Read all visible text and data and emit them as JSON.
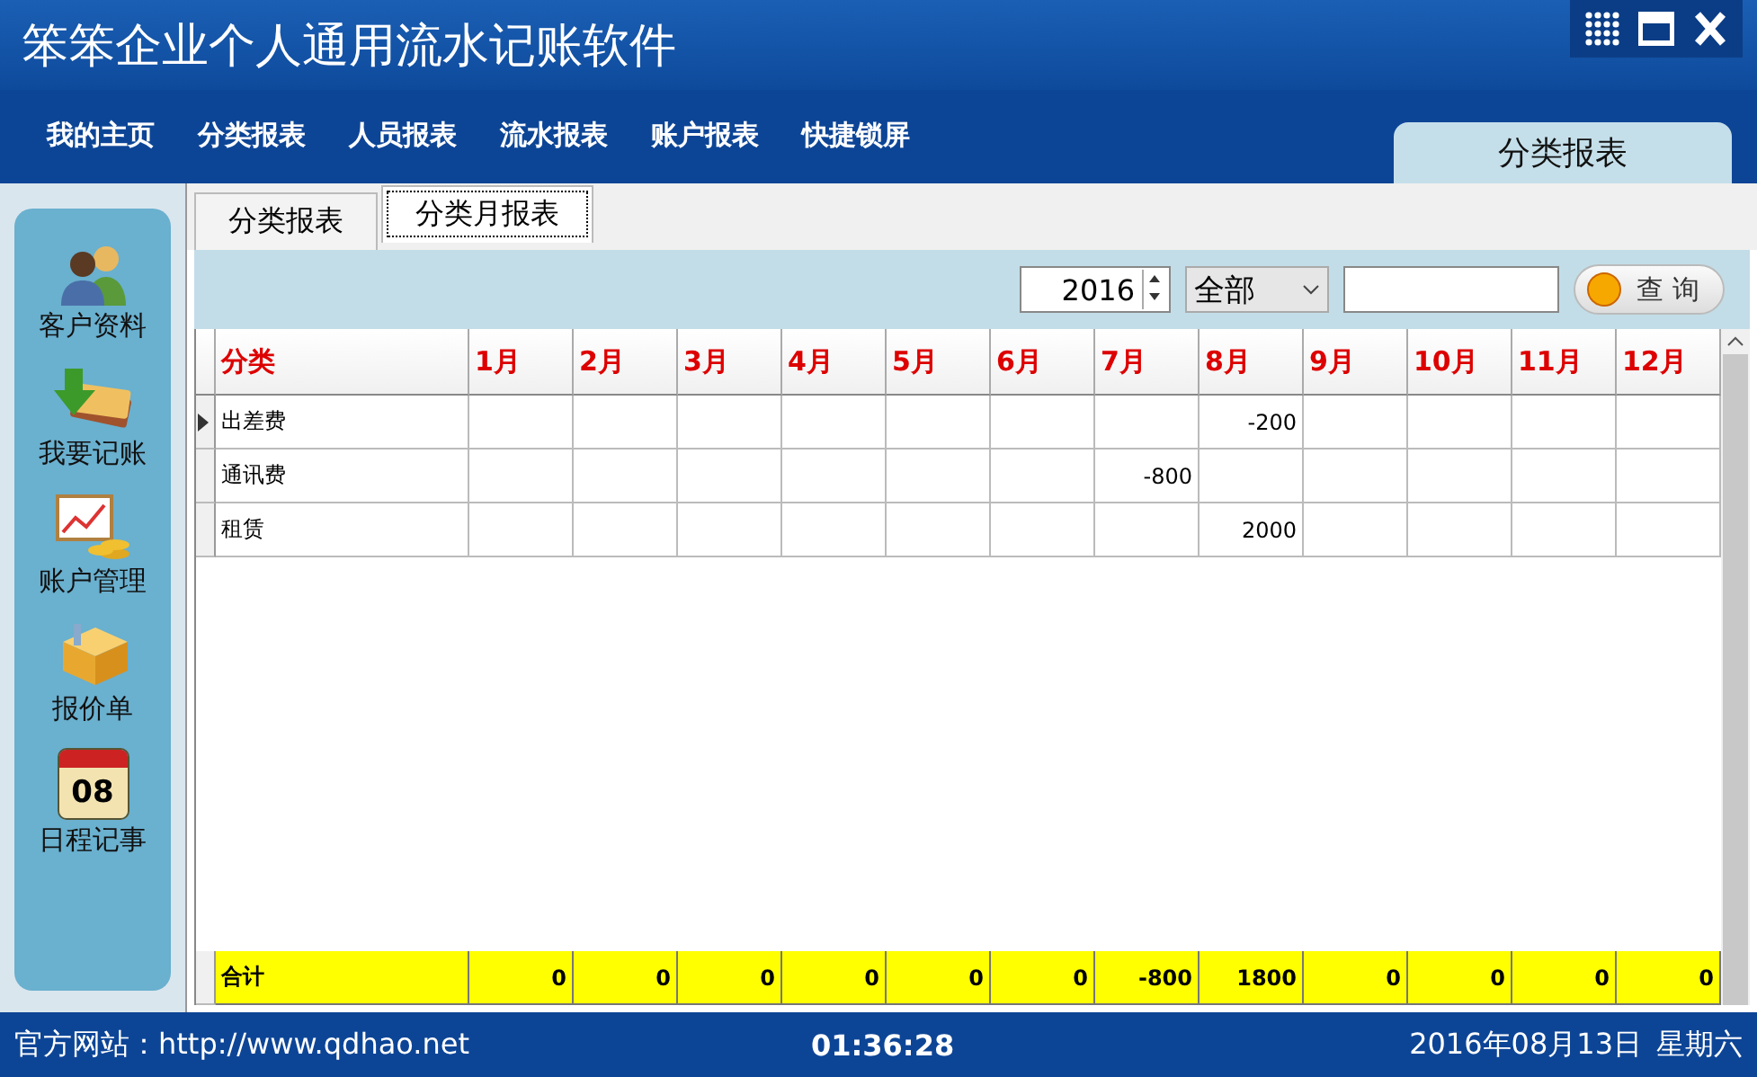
{
  "window": {
    "title": "笨笨企业个人通用流水记账软件"
  },
  "menu": [
    "我的主页",
    "分类报表",
    "人员报表",
    "流水报表",
    "账户报表",
    "快捷锁屏"
  ],
  "current_page": "分类报表",
  "sidebar": {
    "items": [
      {
        "label": "客户资料"
      },
      {
        "label": "我要记账"
      },
      {
        "label": "账户管理"
      },
      {
        "label": "报价单"
      },
      {
        "label": "日程记事",
        "icon_text": "08"
      }
    ]
  },
  "tabs": [
    {
      "label": "分类报表",
      "selected": false
    },
    {
      "label": "分类月报表",
      "selected": true
    }
  ],
  "toolbar": {
    "year": "2016",
    "filter": "全部",
    "query_button": "查 询"
  },
  "table": {
    "columns": [
      "分类",
      "1月",
      "2月",
      "3月",
      "4月",
      "5月",
      "6月",
      "7月",
      "8月",
      "9月",
      "10月",
      "11月",
      "12月"
    ],
    "rows": [
      {
        "current": true,
        "cells": [
          "出差费",
          "",
          "",
          "",
          "",
          "",
          "",
          "",
          "-200",
          "",
          "",
          "",
          ""
        ]
      },
      {
        "current": false,
        "cells": [
          "通讯费",
          "",
          "",
          "",
          "",
          "",
          "",
          "-800",
          "",
          "",
          "",
          "",
          ""
        ]
      },
      {
        "current": false,
        "cells": [
          "租赁",
          "",
          "",
          "",
          "",
          "",
          "",
          "",
          "2000",
          "",
          "",
          "",
          ""
        ]
      }
    ],
    "total": [
      "合计",
      "0",
      "0",
      "0",
      "0",
      "0",
      "0",
      "-800",
      "1800",
      "0",
      "0",
      "0",
      "0"
    ]
  },
  "status_bar": {
    "website": "官方网站：http://www.qdhao.net",
    "time": "01:36:28",
    "date": "2016年08月13日",
    "weekday": "星期六"
  }
}
